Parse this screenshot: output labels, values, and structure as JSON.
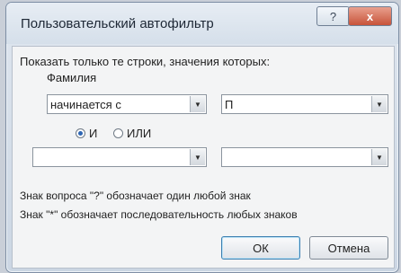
{
  "dialog": {
    "title": "Пользовательский автофильтр",
    "help_glyph": "?",
    "close_glyph": "x"
  },
  "prompt": "Показать только те строки, значения которых:",
  "field_name": "Фамилия",
  "row1": {
    "operator": "начинается с",
    "value": "П"
  },
  "row2": {
    "operator": "",
    "value": ""
  },
  "logic": {
    "and_label": "И",
    "or_label": "ИЛИ",
    "selected": "and"
  },
  "hints": {
    "question": "Знак вопроса \"?\" обозначает один любой знак",
    "star": "Знак \"*\" обозначает последовательность любых знаков"
  },
  "buttons": {
    "ok": "ОК",
    "cancel": "Отмена"
  },
  "icons": {
    "dropdown": "▼"
  }
}
